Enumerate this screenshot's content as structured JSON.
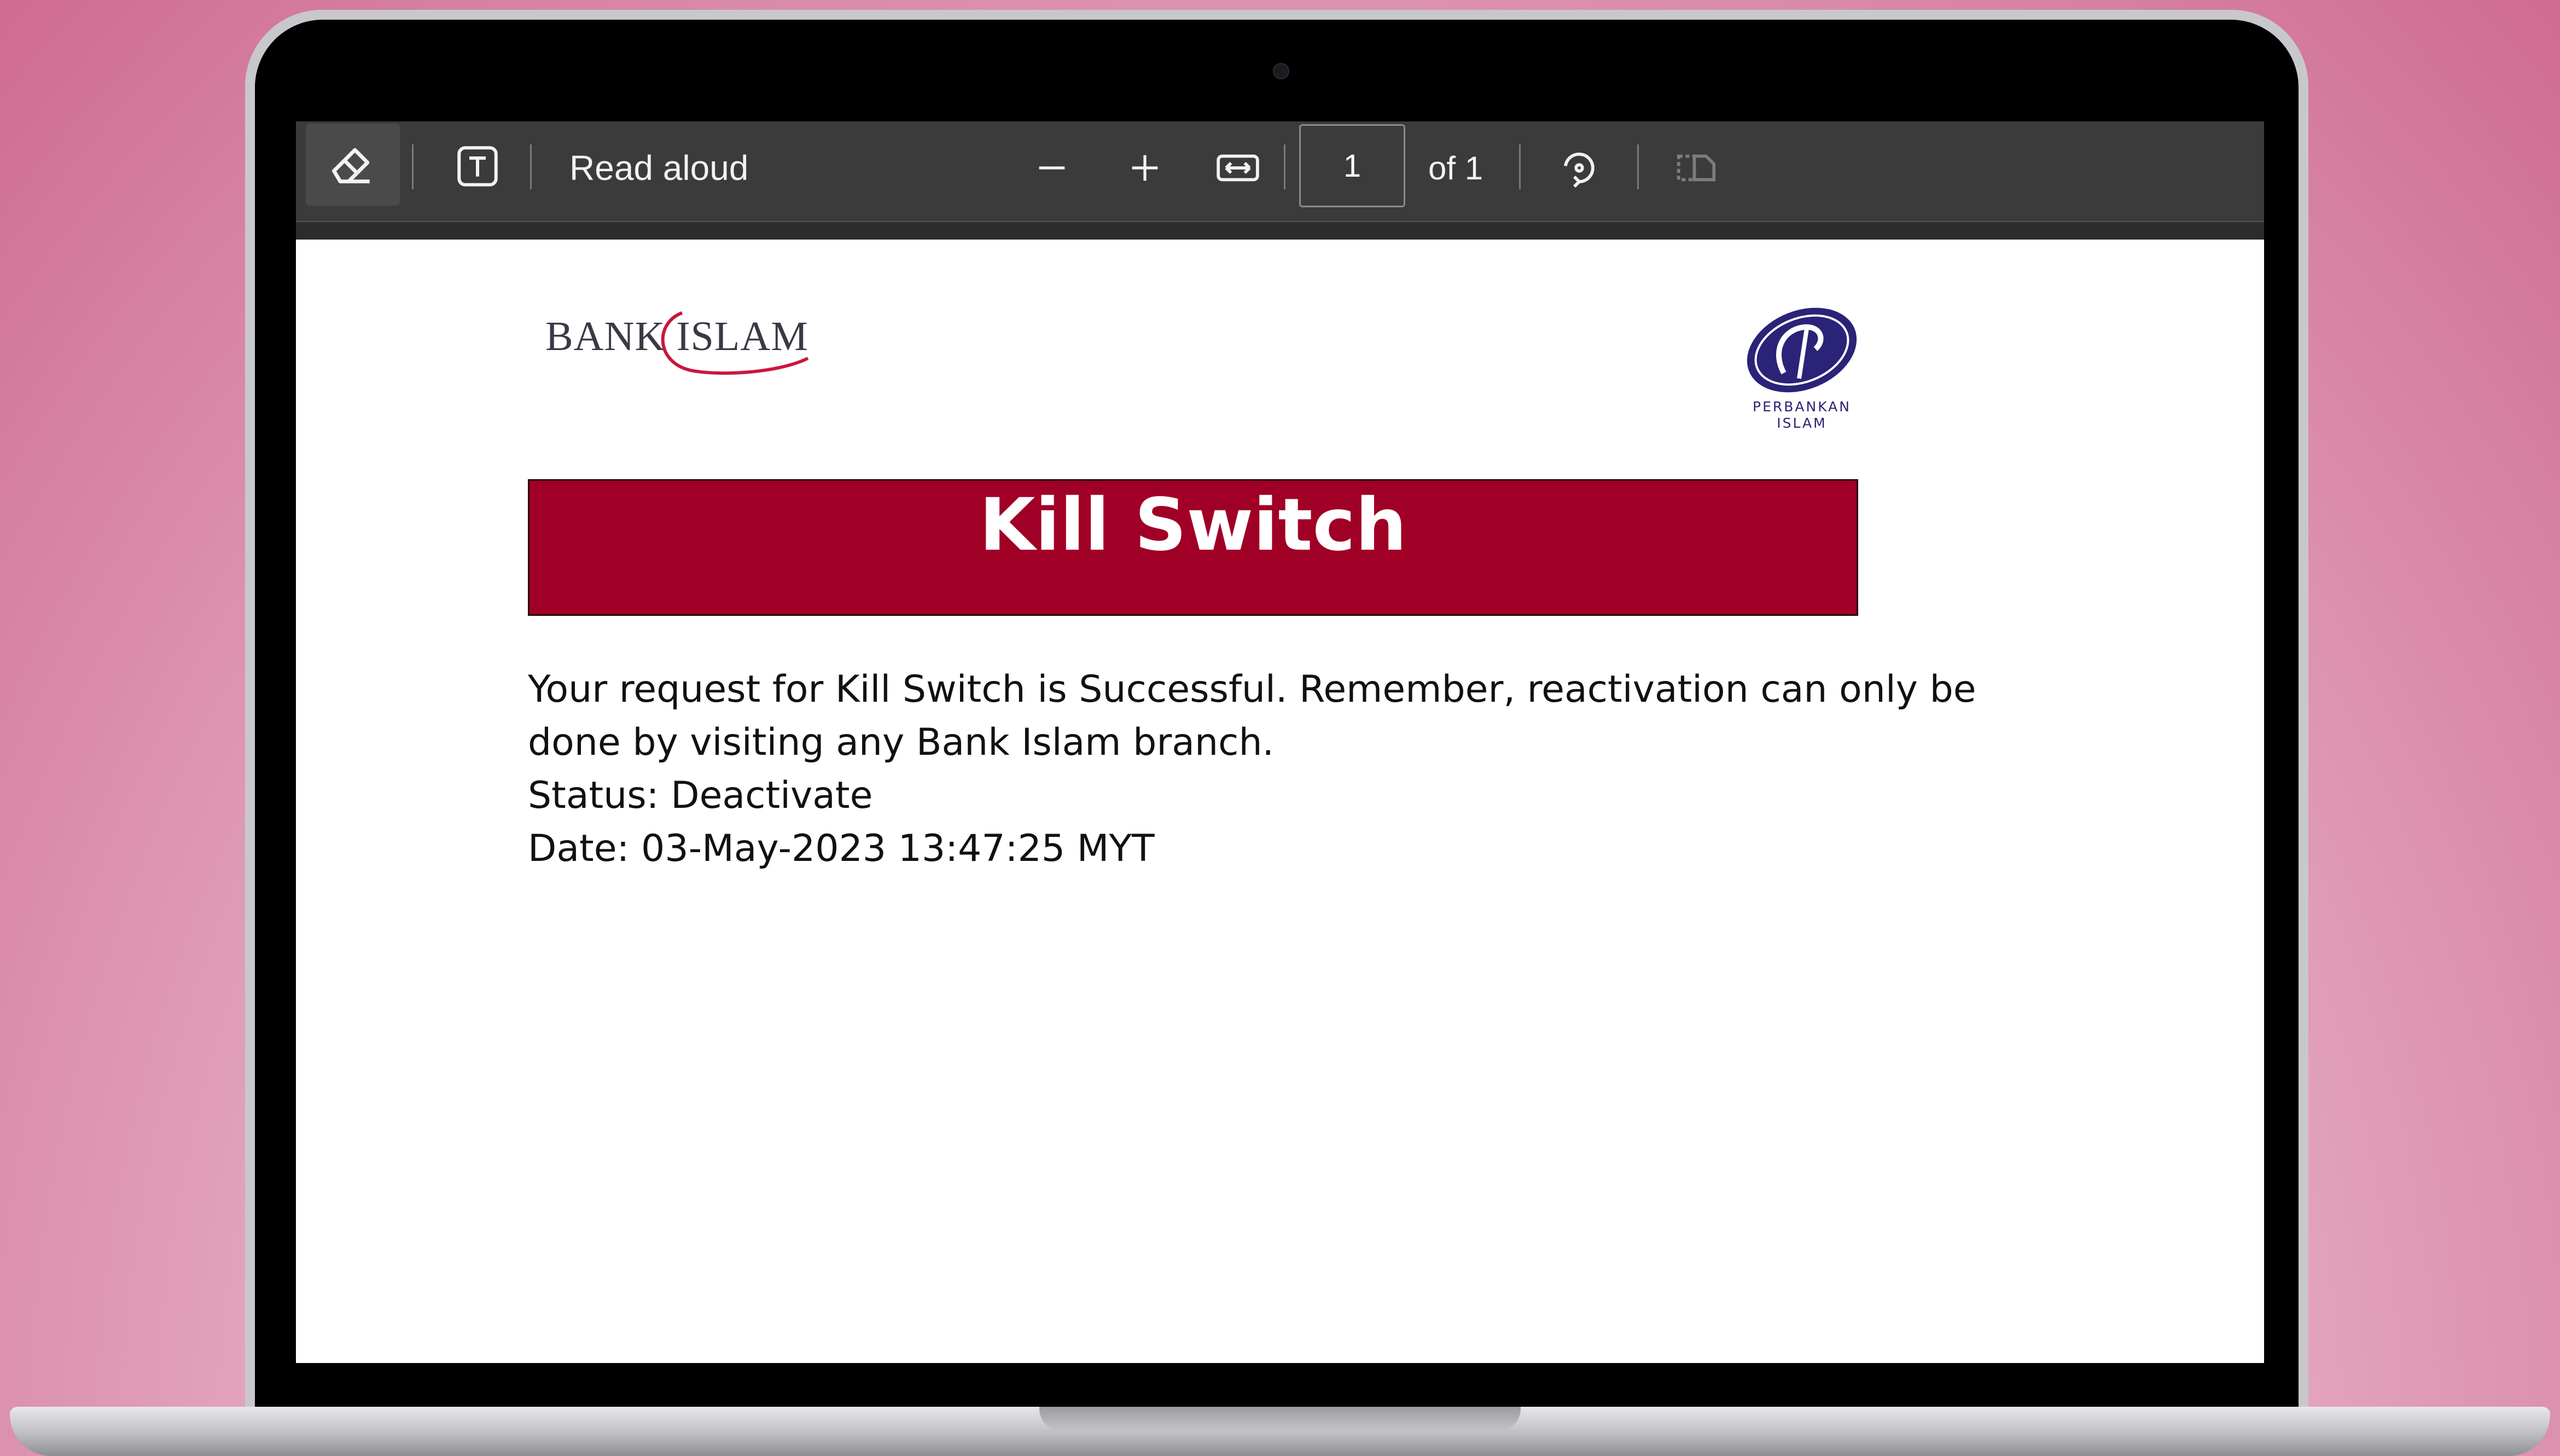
{
  "toolbar": {
    "read_aloud_label": "Read aloud",
    "current_page": "1",
    "page_total_label": "of 1",
    "icons": [
      "eraser-icon",
      "text-box-icon",
      "zoom-out-icon",
      "zoom-in-icon",
      "fit-width-icon",
      "rotate-icon",
      "two-page-view-icon"
    ]
  },
  "document": {
    "bank_logo_text": "BANK ISLAM",
    "secondary_logo_text": [
      "PERBANKAN",
      "ISLAM"
    ],
    "banner_title": "Kill Switch",
    "message_line_1": "Your request for Kill Switch is Successful. Remember, reactivation can only be",
    "message_line_2": "done by visiting any Bank Islam branch.",
    "status_line": "Status: Deactivate",
    "date_line": "Date: 03-May-2023 13:47:25 MYT"
  },
  "colors": {
    "banner": "#a00026",
    "toolbar": "#3b3b3b",
    "logo_navy": "#2b2377"
  }
}
